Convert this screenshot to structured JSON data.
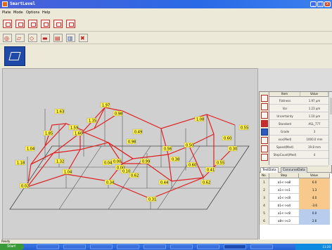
{
  "window": {
    "title": "SmartLevel",
    "min_label": "_",
    "max_label": "□",
    "close_label": "x"
  },
  "menu": [
    "Plate",
    "Mode",
    "Options",
    "Help"
  ],
  "graph_labels": [
    "1.63",
    "1.97",
    "0.98",
    "1.59",
    "1.08",
    "1.85",
    "1.35",
    "1.60",
    "0.49",
    "0.50",
    "0.55",
    "0.60",
    "0.56",
    "0.98",
    "1.04",
    "1.18",
    "1.04",
    "0.99",
    "0.44",
    "0.38",
    "0.41",
    "1.32",
    "0.55",
    "0.60",
    "0.62",
    "0.34",
    "0.62",
    "0.31",
    "0.02",
    "0.00",
    "0.10",
    "0.04",
    "0.00",
    "0.30"
  ],
  "results": {
    "header_item": "Item",
    "header_value": "Value",
    "rows": [
      {
        "item": "Flatness",
        "value": "1.97 μm"
      },
      {
        "item": "Var",
        "value": "1.23 μm"
      },
      {
        "item": "Uncertainty",
        "value": "1.10 μm"
      },
      {
        "item": "Standard",
        "value": "ASL_777"
      },
      {
        "item": "Grade",
        "value": "3"
      },
      {
        "item": "xxx(Med)",
        "value": "1000.0 mm"
      },
      {
        "item": "Speed(Med)",
        "value": "19.8 mm"
      },
      {
        "item": "StepCount(Med)",
        "value": "4"
      },
      {
        "item": "",
        "value": ""
      }
    ]
  },
  "tabs": {
    "tab1": "TestData",
    "tab2": "ConcurseData"
  },
  "test_table": {
    "h_no": "No.",
    "h_step": "Step",
    "h_value": "Value",
    "rows": [
      {
        "no": "1",
        "step": "a1<->a8",
        "value": "6.0",
        "color": "orange"
      },
      {
        "no": "2",
        "step": "a1<->c1",
        "value": "1.3",
        "color": "orange"
      },
      {
        "no": "3",
        "step": "a1<->c8",
        "value": "4.0",
        "color": "orange"
      },
      {
        "no": "4",
        "step": "b1<->a4",
        "value": "-3.6",
        "color": "orange"
      },
      {
        "no": "5",
        "step": "a1<->c8",
        "value": "0.0",
        "color": "blue"
      },
      {
        "no": "6",
        "step": "a8<->c3",
        "value": "2.6",
        "color": "blue"
      }
    ]
  },
  "status_text": "Ready",
  "taskbar": {
    "start_label": "Start",
    "clock": "11:20"
  }
}
